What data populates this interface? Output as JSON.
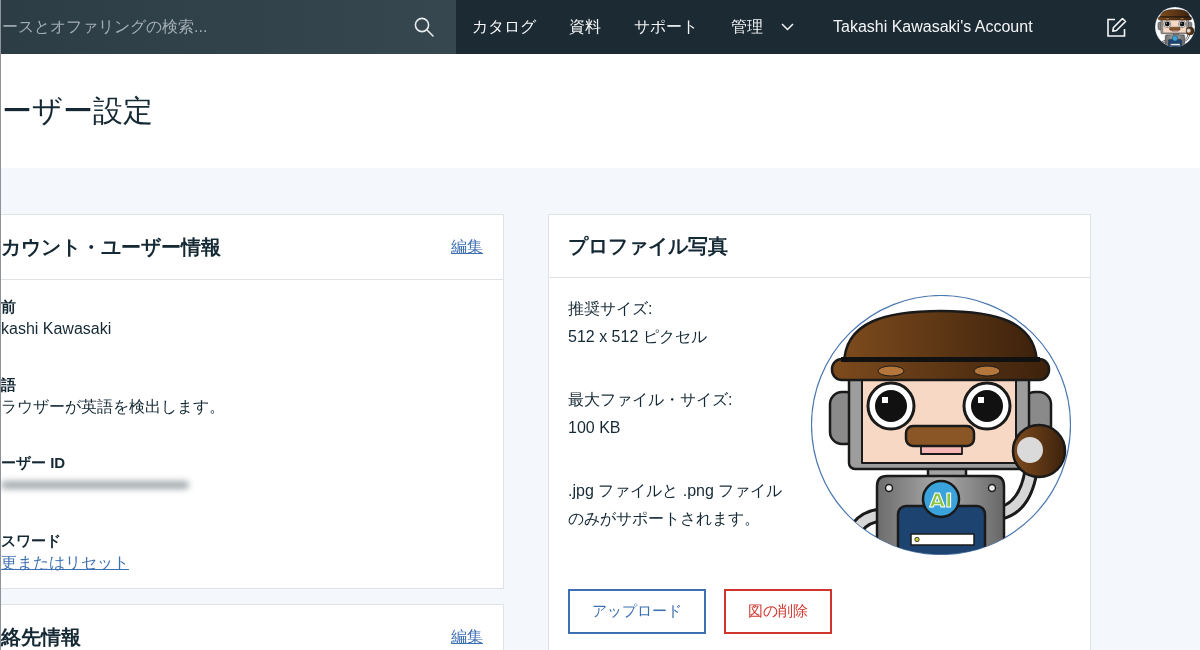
{
  "top_bar": {
    "search": {
      "placeholder": "ースとオファリングの検索..."
    },
    "nav_items": [
      {
        "label": "カタログ",
        "kind": "link"
      },
      {
        "label": "資料",
        "kind": "link"
      },
      {
        "label": "サポート",
        "kind": "link"
      },
      {
        "label": "管理",
        "kind": "menu"
      },
      {
        "label": "Takashi Kawasaki's Account",
        "kind": "link"
      }
    ]
  },
  "page_title": "ーザー設定",
  "left_cards": [
    {
      "title": "カウント・ユーザー情報",
      "action": "編集",
      "fields": [
        {
          "label": "前",
          "value": "kashi Kawasaki",
          "kind": "text"
        },
        {
          "label": "語",
          "value": "ラウザーが英語を検出します。",
          "kind": "text"
        },
        {
          "label": "ーザー ID",
          "kind": "redacted"
        },
        {
          "label": "スワード",
          "value": "更またはリセット",
          "kind": "link"
        }
      ]
    },
    {
      "title": "絡先情報",
      "action": "編集"
    }
  ],
  "photo_card": {
    "title": "プロファイル写真",
    "specs": [
      {
        "label": "推奨サイズ:",
        "value": "512 x 512 ピクセル"
      },
      {
        "label": "最大ファイル・サイズ:",
        "value": "100 KB"
      }
    ],
    "note": ".jpg ファイルと .png ファイルのみがサポートされます。",
    "photo": {
      "badge_text": "AI"
    },
    "buttons": [
      {
        "label": "アップロード",
        "kind": "primary"
      },
      {
        "label": "図の削除",
        "kind": "danger"
      }
    ]
  }
}
